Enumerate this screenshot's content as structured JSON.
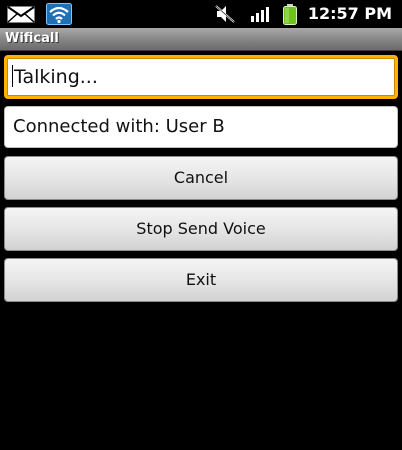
{
  "status_bar": {
    "time": "12:57 PM",
    "icons": [
      "mail-icon",
      "wifi-icon",
      "mute-icon",
      "signal-icon",
      "battery-icon"
    ],
    "colors": {
      "wifi": "#3aa0e8",
      "battery": "#6ec21f"
    }
  },
  "app": {
    "title": "Wificall"
  },
  "fields": {
    "talking": "Talking...",
    "connected": "Connected with: User B"
  },
  "buttons": {
    "cancel": "Cancel",
    "stop_send_voice": "Stop Send Voice",
    "exit": "Exit"
  },
  "colors": {
    "focus_border": "#ffb300",
    "title_bar": "#8a8a8a",
    "background": "#000000"
  }
}
